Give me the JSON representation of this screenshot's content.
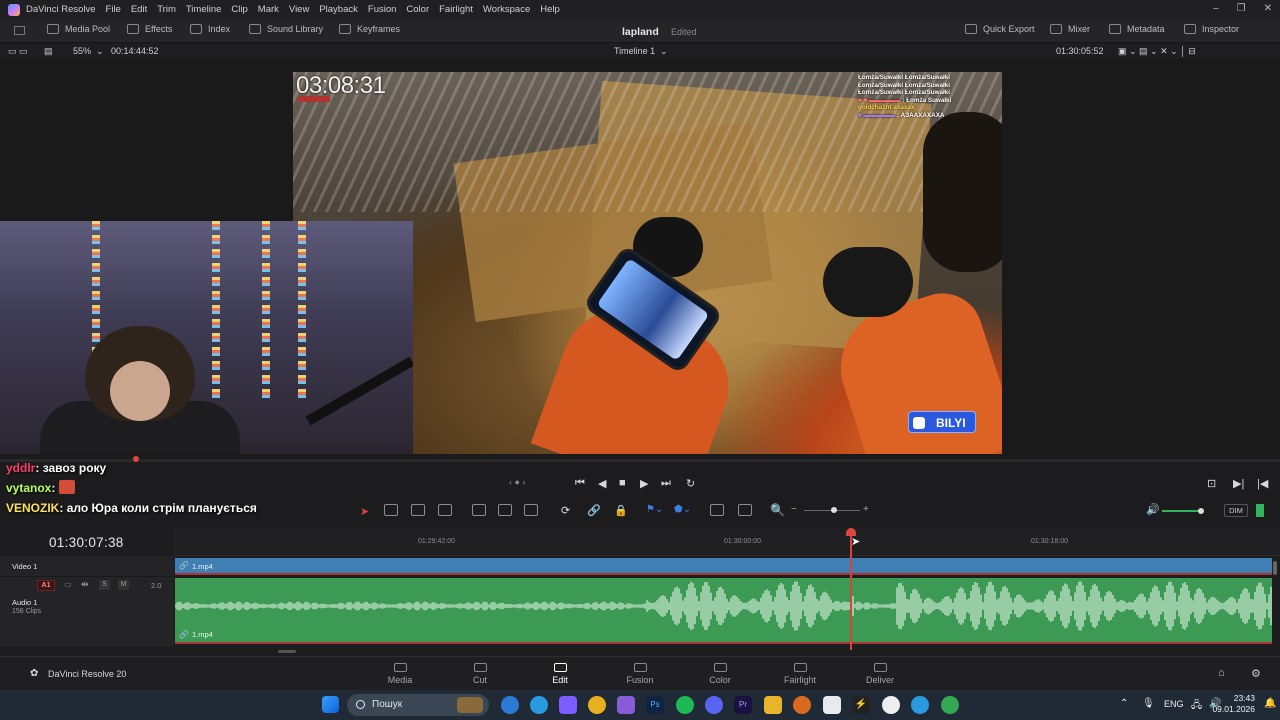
{
  "menubar": {
    "app_name": "DaVinci Resolve",
    "items": [
      "File",
      "Edit",
      "Trim",
      "Timeline",
      "Clip",
      "Mark",
      "View",
      "Playback",
      "Fusion",
      "Color",
      "Fairlight",
      "Workspace",
      "Help"
    ]
  },
  "toolbar": {
    "media_pool": "Media Pool",
    "effects": "Effects",
    "index": "Index",
    "sound_library": "Sound Library",
    "keyframes": "Keyframes",
    "project_title": "lapland",
    "project_status": "Edited",
    "quick_export": "Quick Export",
    "mixer": "Mixer",
    "metadata": "Metadata",
    "inspector": "Inspector"
  },
  "viewer": {
    "zoom": "55%",
    "source_timecode": "00:14:44:52",
    "timeline_name": "Timeline 1",
    "record_timecode": "01:30:05:52"
  },
  "frame_overlay": {
    "timer": "03:08:31",
    "chat_lines": [
      "Łomża/Suwałki Łomża/Suwałki",
      "Łomża/Suwałki Łomża/Suwałki",
      "Łomża/Suwałki Łomża/Suwałki",
      ": Łomża Suwałki",
      "goldcha1nt axaxax",
      ": АЗААХАХАХА"
    ],
    "badge": "BILYI"
  },
  "stream_chat": [
    {
      "user": "yddlr",
      "text": "завоз року"
    },
    {
      "user": "vytanox",
      "text": ""
    },
    {
      "user": "VENOZIK",
      "text": "ало Юра коли стрім планується"
    }
  ],
  "timeline": {
    "timecode": "01:30:07:38",
    "ruler_marks": [
      "01:29:42:00",
      "01:30:00:00",
      "01:30:18:00"
    ],
    "video_track": {
      "name": "Video 1",
      "clip": "1.mp4"
    },
    "audio_track": {
      "name": "Audio 1",
      "badge": "A1",
      "clips": "156 Clips",
      "level": "2.0",
      "clip": "1.mp4"
    },
    "playhead_fraction": 0.615
  },
  "transport": {
    "dim_label": "DIM"
  },
  "pages": [
    {
      "label": "Media",
      "active": false
    },
    {
      "label": "Cut",
      "active": false
    },
    {
      "label": "Edit",
      "active": true
    },
    {
      "label": "Fusion",
      "active": false
    },
    {
      "label": "Color",
      "active": false
    },
    {
      "label": "Fairlight",
      "active": false
    },
    {
      "label": "Deliver",
      "active": false
    }
  ],
  "footer": {
    "version": "DaVinci Resolve 20"
  },
  "taskbar": {
    "search_placeholder": "Пошук",
    "language": "ENG",
    "time": "23:43",
    "date": "09.01.2026"
  },
  "colors": {
    "accent": "#e0453b",
    "video_clip": "#3f7fb4",
    "audio_clip": "#3c9a55",
    "active_page": "#ffffff"
  }
}
